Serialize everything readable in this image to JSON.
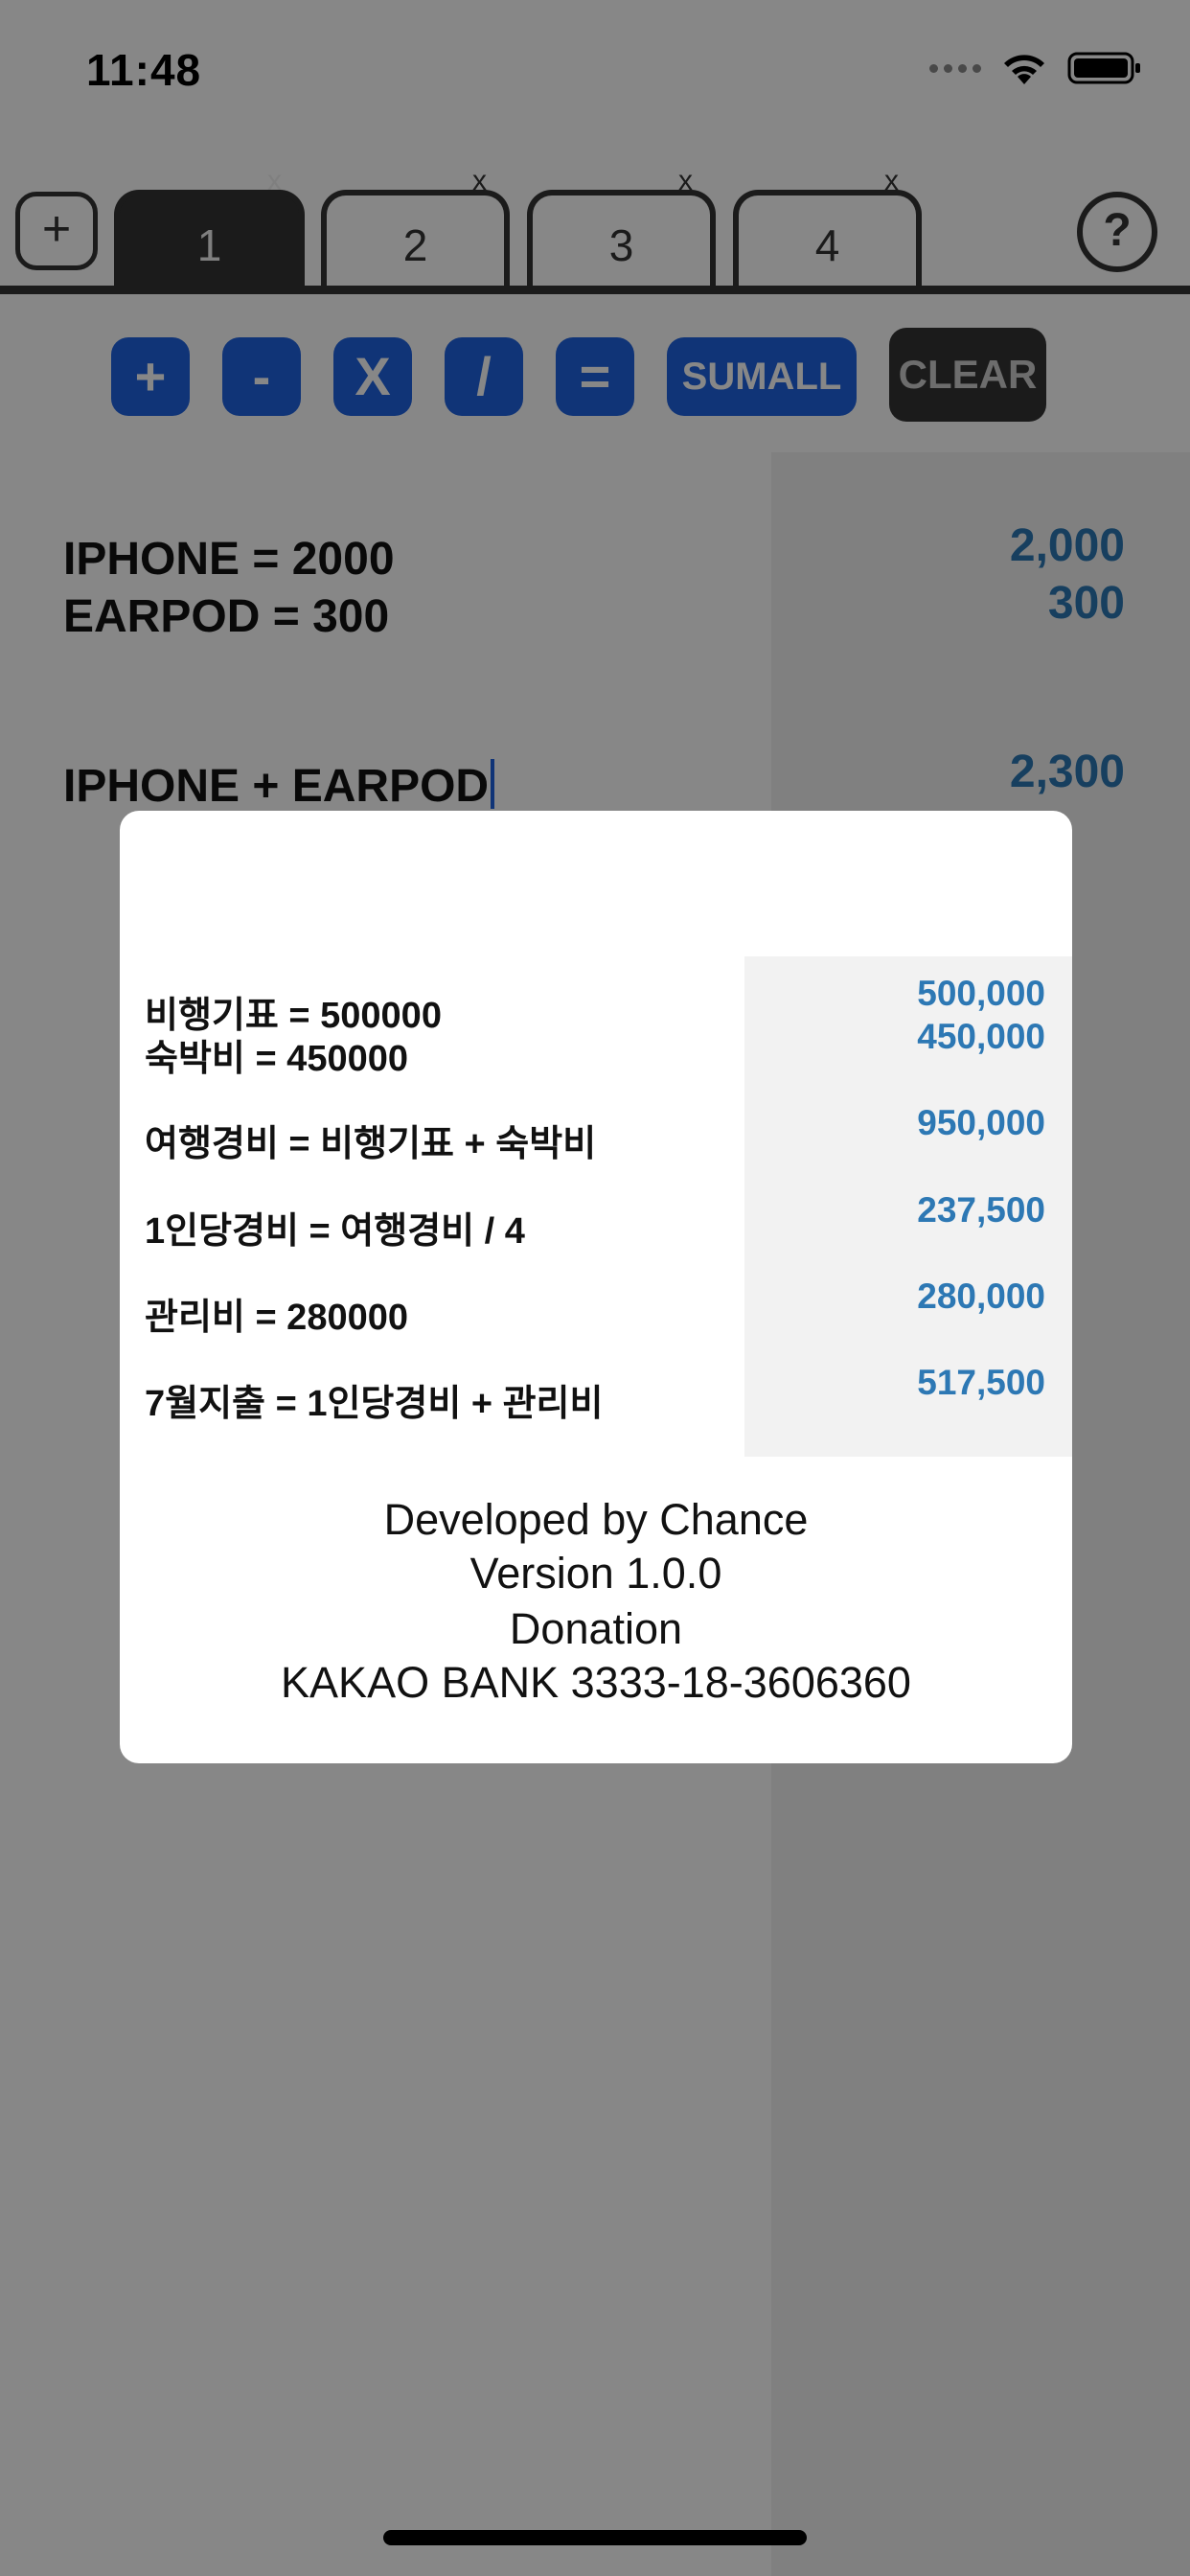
{
  "status_bar": {
    "time": "11:48"
  },
  "tabs": {
    "add_label": "+",
    "close_label": "x",
    "items": [
      {
        "label": "1",
        "active": true
      },
      {
        "label": "2",
        "active": false
      },
      {
        "label": "3",
        "active": false
      },
      {
        "label": "4",
        "active": false
      }
    ],
    "help_label": "?"
  },
  "operators": {
    "plus": "+",
    "minus": "-",
    "multiply": "X",
    "divide": "/",
    "equals": "=",
    "sumall": "SUMALL",
    "clear": "CLEAR"
  },
  "editor": {
    "lines": [
      "IPHONE = 2000",
      "EARPOD = 300",
      "IPHONE + EARPOD"
    ],
    "results": [
      "2,000",
      "300",
      "2,300"
    ]
  },
  "help_modal": {
    "example_lines": [
      "비행기표 = 500000",
      "숙박비 = 450000",
      "여행경비 = 비행기표 + 숙박비",
      "1인당경비 = 여행경비 / 4",
      "관리비 = 280000",
      "7월지출 = 1인당경비 + 관리비"
    ],
    "example_results": [
      "500,000",
      "450,000",
      "950,000",
      "237,500",
      "280,000",
      "517,500"
    ],
    "developer": "Developed by Chance",
    "version": "Version 1.0.0",
    "donation": "Donation",
    "account": "KAKAO BANK 3333-18-3606360"
  },
  "colors": {
    "operator_blue": "#1f63e0",
    "result_blue": "#2d78b4",
    "dark": "#333333",
    "overlay": "rgba(0,0,0,0.47)"
  }
}
